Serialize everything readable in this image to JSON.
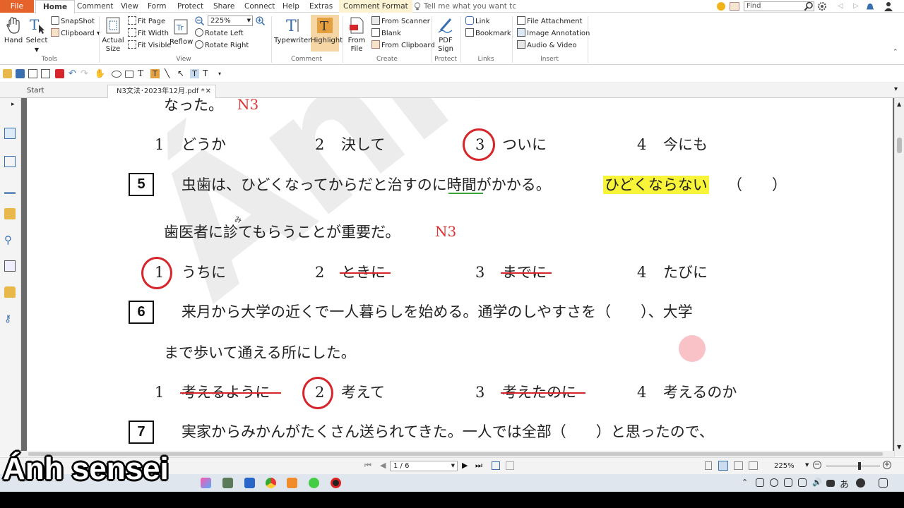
{
  "menubar": {
    "file": "File",
    "tabs": [
      "Home",
      "Comment",
      "View",
      "Form",
      "Protect",
      "Share",
      "Connect",
      "Help",
      "Extras",
      "Comment Format"
    ],
    "tell_me": "Tell me what you want tc",
    "find_placeholder": "Find"
  },
  "ribbon": {
    "hand": "Hand",
    "select": "Select",
    "snapshot": "SnapShot",
    "clipboard": "Clipboard",
    "tools_group": "Tools",
    "actual_size": [
      "Actual",
      "Size"
    ],
    "fit_page": "Fit Page",
    "fit_width": "Fit Width",
    "fit_visible": "Fit Visible",
    "zoom": "225%",
    "reflow": "Reflow",
    "rotate_left": "Rotate Left",
    "rotate_right": "Rotate Right",
    "view_group": "View",
    "typewriter": "Typewriter",
    "highlight": "Highlight",
    "comment_group": "Comment",
    "from_file": [
      "From",
      "File"
    ],
    "from_scanner": "From Scanner",
    "blank": "Blank",
    "from_clipboard": "From Clipboard",
    "create_group": "Create",
    "pdf_sign": [
      "PDF",
      "Sign"
    ],
    "protect_group": "Protect",
    "link": "Link",
    "bookmark": "Bookmark",
    "links_group": "Links",
    "file_attachment": "File Attachment",
    "image_annotation": "Image Annotation",
    "audio_video": "Audio & Video",
    "insert_group": "Insert"
  },
  "tabs": {
    "start": "Start",
    "document": "N3文法･2023年12月.pdf *"
  },
  "document": {
    "line_top": "なった。",
    "n3": "N3",
    "q4_options": [
      "1",
      "どうか",
      "2",
      "決して",
      "3",
      "ついに",
      "4",
      "今にも"
    ],
    "q5_num": "5",
    "q5_text_a": "虫歯は、ひどくなってからだと治す",
    "q5_text_ni": "のに",
    "q5_text_b": "時間がかかる。",
    "q5_highlight": "ひどくならない",
    "q5_paren": "（　　）",
    "q5_line2": "歯医者に診てもらうことが重要だ。",
    "q5_furigana": "み",
    "q5_options": [
      "1",
      "うちに",
      "2",
      "ときに",
      "3",
      "までに",
      "4",
      "たびに"
    ],
    "q6_num": "6",
    "q6_line1": "来月から大学の近くで一人暮らしを始める。通学のしやすさを（　　）、大学",
    "q6_line2": "まで歩いて通える所にした。",
    "q6_options": [
      "1",
      "考えるように",
      "2",
      "考えて",
      "3",
      "考えたのに",
      "4",
      "考えるのか"
    ],
    "q7_num": "7",
    "q7_line1": "実家からみかんがたくさん送られてきた。一人では全部（　　）と思ったので、"
  },
  "status": {
    "page": "1 / 6",
    "zoom": "225%"
  },
  "caption": "Ánh sensei",
  "colors": {
    "file_tab": "#e5622a",
    "answer_circle": "#d7262b",
    "highlight": "#f7f43a"
  }
}
